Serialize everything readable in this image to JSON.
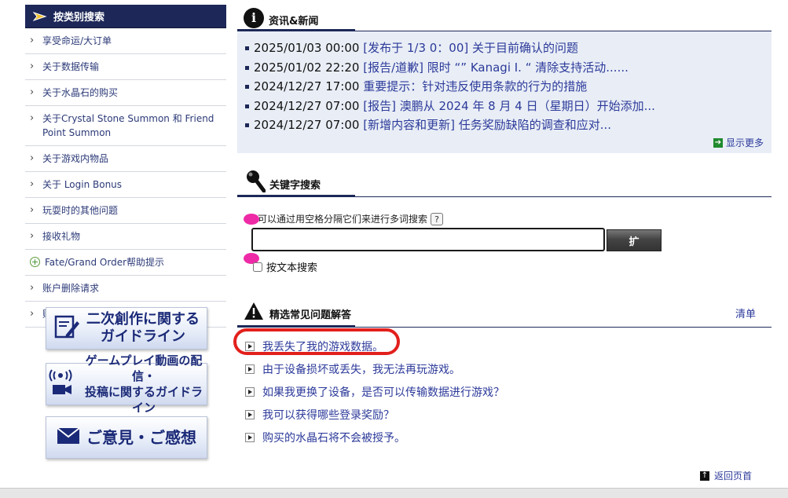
{
  "sidebar": {
    "header": "按类别搜索",
    "items": [
      {
        "label": "享受命运/大订单",
        "icon": "chevron-right"
      },
      {
        "label": "关于数据传输",
        "icon": "chevron-right"
      },
      {
        "label": "关于水晶石的购买",
        "icon": "chevron-right"
      },
      {
        "label": "关于Crystal Stone Summon 和 Friend Point Summon",
        "icon": "chevron-right"
      },
      {
        "label": "关于游戏内物品",
        "icon": "chevron-right"
      },
      {
        "label": "关于 Login Bonus",
        "icon": "chevron-right"
      },
      {
        "label": "玩耍时的其他问题",
        "icon": "chevron-right"
      },
      {
        "label": "接收礼物",
        "icon": "chevron-right"
      },
      {
        "label": "Fate/Grand Order帮助提示",
        "icon": "plus-circle"
      },
      {
        "label": "账户删除请求",
        "icon": "chevron-right"
      },
      {
        "label": "账户删除请求 [取消]",
        "icon": "chevron-right"
      }
    ],
    "banners": [
      {
        "text": "二次創作に関する\nガイドライン",
        "icon": "document-pen-icon"
      },
      {
        "text": "ゲームプレイ動画の配信・\n投稿に関するガイドライン",
        "icon": "broadcast-camera-icon"
      },
      {
        "text": "ご意見・ご感想",
        "icon": "envelope-icon"
      }
    ]
  },
  "news": {
    "title": "资讯&新闻",
    "items": [
      {
        "date": "2025/01/03 00:00",
        "text": "[发布于 1/3 0：00] 关于目前确认的问题"
      },
      {
        "date": "2025/01/02 22:20",
        "text": "[报告/道歉] 限时 “” Kanagi I. “ 清除支持活动......"
      },
      {
        "date": "2024/12/27 17:00",
        "text": "重要提示：针对违反使用条款的行为的措施"
      },
      {
        "date": "2024/12/27 07:00",
        "text": "[报告] 澳鹏从 2024 年 8 月 4 日（星期日）开始添加..."
      },
      {
        "date": "2024/12/27 07:00",
        "text": "[新增内容和更新] 任务奖励缺陷的调查和应对..."
      }
    ],
    "show_more": "显示更多"
  },
  "search": {
    "title": "关键字搜索",
    "hint": "可以通过用空格分隔它们来进行多词搜索",
    "help_icon": "?",
    "input_value": "",
    "button_label": "扩",
    "text_search_label": "按文本搜索"
  },
  "faq": {
    "title": "精选常见问题解答",
    "list_link": "清单",
    "items": [
      "我丢失了我的游戏数据。",
      "由于设备损坏或丢失，我无法再玩游戏。",
      "如果我更换了设备，是否可以传输数据进行游戏？",
      "我可以获得哪些登录奖励？",
      "购买的水晶石将不会被授予。"
    ]
  },
  "footer": {
    "back_to_top": "返回页首"
  },
  "colors": {
    "navy": "#1d2858",
    "link": "#2c3a9a",
    "highlight": "#e2201c",
    "pin": "#ee2aa6"
  }
}
